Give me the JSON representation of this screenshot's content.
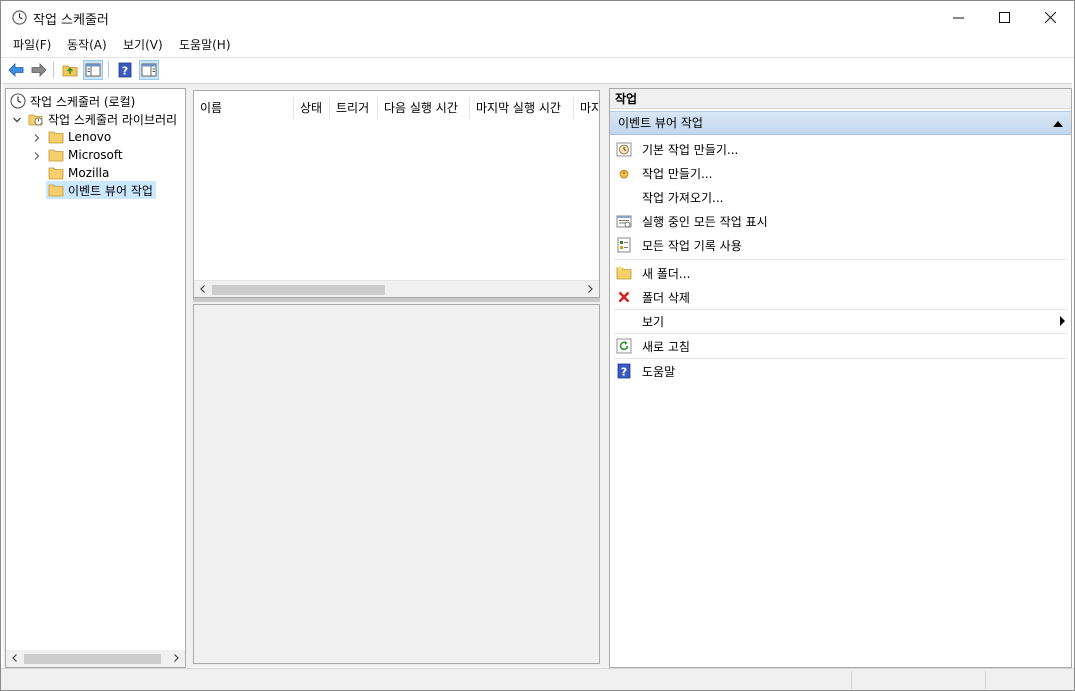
{
  "window": {
    "title": "작업 스케줄러"
  },
  "menu": {
    "file": "파일(F)",
    "action": "동작(A)",
    "view": "보기(V)",
    "help": "도움말(H)"
  },
  "tree": {
    "root": "작업 스케줄러 (로컬)",
    "library": "작업 스케줄러 라이브러리",
    "folders": [
      "Lenovo",
      "Microsoft",
      "Mozilla",
      "이벤트 뷰어 작업"
    ]
  },
  "table": {
    "columns": [
      "이름",
      "상태",
      "트리거",
      "다음 실행 시간",
      "마지막 실행 시간",
      "마지"
    ]
  },
  "actions": {
    "header": "작업",
    "section": "이벤트 뷰어 작업",
    "items": [
      "기본 작업 만들기...",
      "작업 만들기...",
      "작업 가져오기...",
      "실행 중인 모든 작업 표시",
      "모든 작업 기록 사용",
      "새 폴더...",
      "폴더 삭제",
      "보기",
      "새로 고침",
      "도움말"
    ]
  },
  "icons": {
    "app": "clock-icon",
    "back": "back-arrow-icon",
    "forward": "forward-arrow-icon",
    "up": "up-folder-icon",
    "show_hide_tree": "console-tree-icon",
    "help": "help-icon",
    "show_hide_action": "action-pane-icon"
  },
  "colors": {
    "selection": "#cce8ff",
    "section_header": "#c3d7ee",
    "folder": "#f5cf6b",
    "delete": "#d91e18",
    "help_icon": "#3a5bbf"
  }
}
